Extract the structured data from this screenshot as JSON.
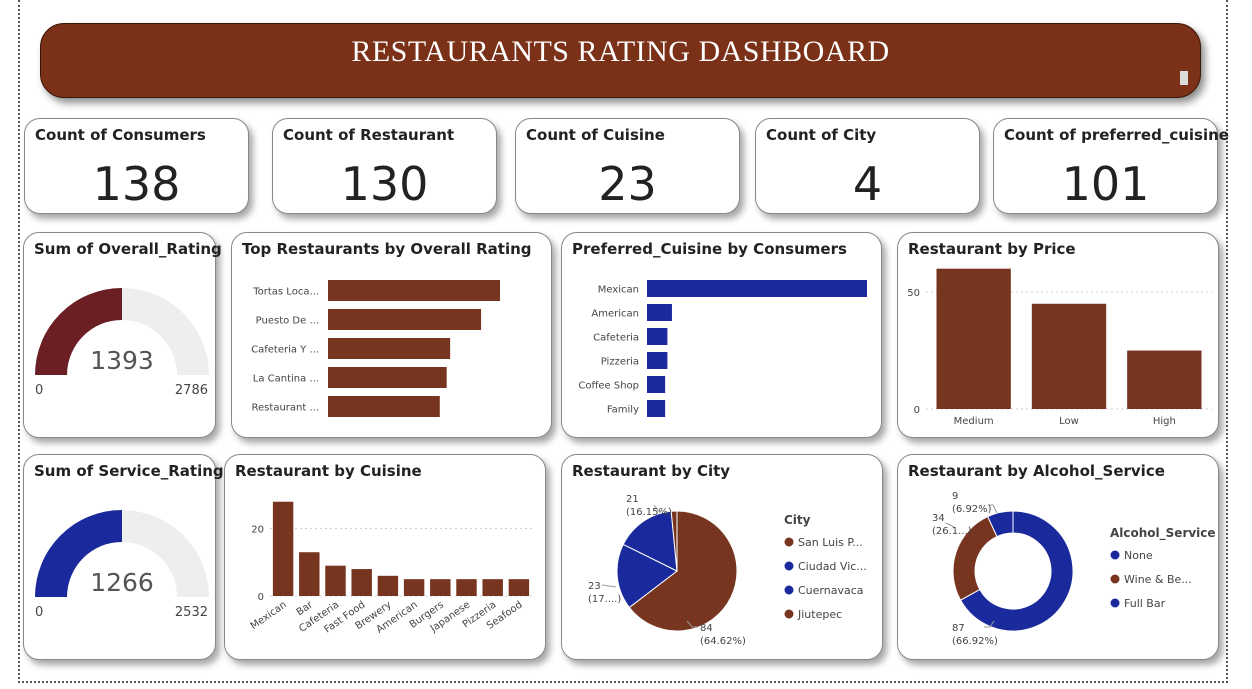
{
  "header": {
    "title": "RESTAURANTS RATING DASHBOARD"
  },
  "kpis": [
    {
      "label": "Count of Consumers",
      "value": "138"
    },
    {
      "label": "Count of Restaurant",
      "value": "130"
    },
    {
      "label": "Count of Cuisine",
      "value": "23"
    },
    {
      "label": "Count of City",
      "value": "4"
    },
    {
      "label": "Count of preferred_cuisine",
      "value": "101"
    }
  ],
  "colors": {
    "brown": "#773520",
    "blue": "#1a2a9c",
    "maroon": "#6b1f25",
    "gauge_bg": "#efeeee"
  },
  "chart_data": [
    {
      "type": "gauge",
      "title": "Sum of Overall_Rating",
      "value": 1393,
      "min": 0,
      "max": 2786,
      "value_label": "1393",
      "min_label": "0",
      "max_label": "2786"
    },
    {
      "type": "bar",
      "orientation": "horizontal",
      "title": "Top Restaurants by Overall Rating",
      "categories": [
        "Tortas Loca...",
        "Puesto De ...",
        "Cafeteria Y ...",
        "La Cantina ...",
        "Restaurant ..."
      ],
      "values": [
        10,
        8.9,
        7.1,
        6.9,
        6.5
      ]
    },
    {
      "type": "bar",
      "orientation": "horizontal",
      "title": "Preferred_Cuisine by Consumers",
      "categories": [
        "Mexican",
        "American",
        "Cafeteria",
        "Pizzeria",
        "Coffee Shop",
        "Family"
      ],
      "values": [
        97,
        11,
        9,
        9,
        8,
        8
      ]
    },
    {
      "type": "bar",
      "title": "Restaurant by Price",
      "categories": [
        "Medium",
        "Low",
        "High"
      ],
      "values": [
        60,
        45,
        25
      ],
      "yticks": [
        {
          "v": 0,
          "label": "0"
        },
        {
          "v": 50,
          "label": "50"
        }
      ],
      "ylim": [
        0,
        62
      ]
    },
    {
      "type": "gauge",
      "title": "Sum of Service_Rating",
      "value": 1266,
      "min": 0,
      "max": 2532,
      "value_label": "1266",
      "min_label": "0",
      "max_label": "2532"
    },
    {
      "type": "bar",
      "title": "Restaurant by Cuisine",
      "categories": [
        "Mexican",
        "Bar",
        "Cafeteria",
        "Fast Food",
        "Brewery",
        "American",
        "Burgers",
        "Japanese",
        "Pizzeria",
        "Seafood"
      ],
      "values": [
        28,
        13,
        9,
        8,
        6,
        5,
        5,
        5,
        5,
        5
      ],
      "yticks": [
        {
          "v": 0,
          "label": "0"
        },
        {
          "v": 20,
          "label": "20"
        }
      ],
      "ylim": [
        0,
        30
      ]
    },
    {
      "type": "pie",
      "title": "Restaurant by City",
      "legend_title": "City",
      "legend": [
        "San Luis P...",
        "Ciudad Vic...",
        "Cuernavaca",
        "Jiutepec"
      ],
      "slices": [
        {
          "name": "San Luis P...",
          "value": 84,
          "label": "84",
          "pct": "(64.62%)",
          "color": "#773520"
        },
        {
          "name": "Ciudad Vic...",
          "value": 23,
          "label": "23",
          "pct": "(17....)",
          "color": "#1a2a9c"
        },
        {
          "name": "Cuernavaca",
          "value": 21,
          "label": "21",
          "pct": "(16.15%)",
          "color": "#1a2a9c"
        },
        {
          "name": "Jiutepec",
          "value": 2,
          "label": "",
          "pct": "",
          "color": "#773520"
        }
      ]
    },
    {
      "type": "donut",
      "title": "Restaurant by Alcohol_Service",
      "legend_title": "Alcohol_Service",
      "legend": [
        "None",
        "Wine & Be...",
        "Full Bar"
      ],
      "slices": [
        {
          "name": "None",
          "value": 87,
          "label": "87",
          "pct": "(66.92%)",
          "color": "#1a2a9c"
        },
        {
          "name": "Wine & Be...",
          "value": 34,
          "label": "34",
          "pct": "(26.1...)",
          "color": "#773520"
        },
        {
          "name": "Full Bar",
          "value": 9,
          "label": "9",
          "pct": "(6.92%)",
          "color": "#1a2a9c"
        }
      ]
    }
  ]
}
